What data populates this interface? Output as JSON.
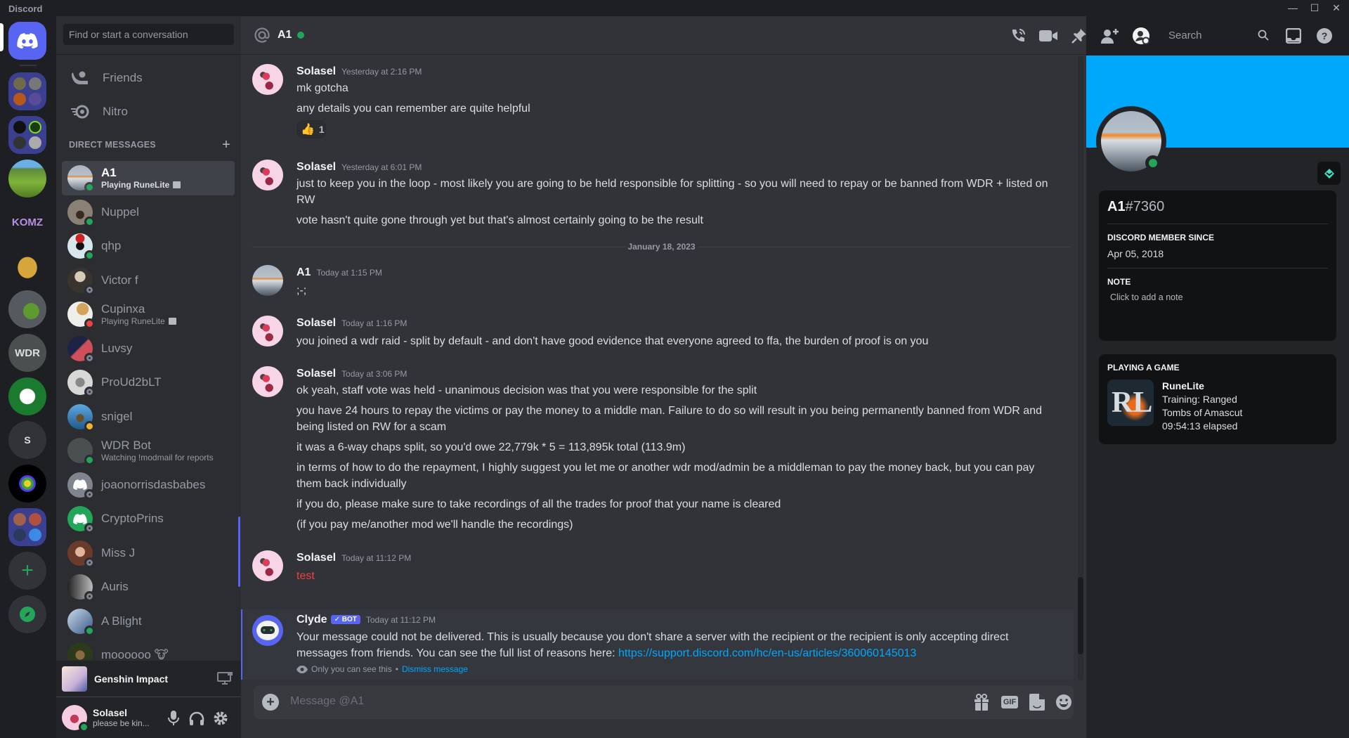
{
  "window": {
    "app_title": "Discord",
    "controls": {
      "minimize": "—",
      "maximize": "☐",
      "close": "✕"
    }
  },
  "server_rail": {
    "home_icon": "discord-logo-icon",
    "servers": [
      {
        "name": "folder-1",
        "kind": "folder"
      },
      {
        "name": "folder-2",
        "kind": "folder"
      },
      {
        "name": "corn-field-server",
        "kind": "image"
      },
      {
        "name": "komz-server",
        "kind": "image",
        "label": "KOMZ"
      },
      {
        "name": "spartan-helmet-server",
        "kind": "image"
      },
      {
        "name": "leaf-server",
        "kind": "image"
      },
      {
        "name": "wdr-server",
        "kind": "image",
        "label": "WDR"
      },
      {
        "name": "brain-server",
        "kind": "image"
      },
      {
        "name": "s-server",
        "kind": "text",
        "label": "S"
      },
      {
        "name": "rainbow-star-server",
        "kind": "image"
      },
      {
        "name": "folder-3",
        "kind": "folder"
      }
    ],
    "add_server_icon": "plus-icon",
    "explore_icon": "compass-icon"
  },
  "dm_sidebar": {
    "search_placeholder": "Find or start a conversation",
    "nav": [
      {
        "label": "Friends",
        "icon": "friends-icon"
      },
      {
        "label": "Nitro",
        "icon": "nitro-icon"
      }
    ],
    "section_title": "DIRECT MESSAGES",
    "add_dm_icon": "plus-icon",
    "dms": [
      {
        "name": "A1",
        "status": "online",
        "sub": "Playing RuneLite",
        "active": true
      },
      {
        "name": "Nuppel",
        "status": "online"
      },
      {
        "name": "qhp",
        "status": "online"
      },
      {
        "name": "Victor f",
        "status": "offline"
      },
      {
        "name": "Cupinxa",
        "status": "dnd",
        "sub": "Playing RuneLite"
      },
      {
        "name": "Luvsy",
        "status": "offline"
      },
      {
        "name": "ProUd2bLT",
        "status": "offline"
      },
      {
        "name": "snigel",
        "status": "idle"
      },
      {
        "name": "WDR Bot",
        "status": "online",
        "sub": "Watching !modmail for reports"
      },
      {
        "name": "joaonorrisdasbabes",
        "status": "offline"
      },
      {
        "name": "CryptoPrins",
        "status": "offline"
      },
      {
        "name": "Miss J",
        "status": "offline"
      },
      {
        "name": "Auris",
        "status": "offline"
      },
      {
        "name": "A Blight",
        "status": "online"
      },
      {
        "name": "moooooo 🐮",
        "status": "offline"
      }
    ],
    "activity": {
      "game": "Genshin Impact"
    },
    "user": {
      "name": "Solasel",
      "status_text": "please be kin...",
      "status": "online"
    }
  },
  "chat": {
    "header": {
      "title": "A1",
      "search_placeholder": "Search"
    },
    "header_icons": [
      "voice-call-icon",
      "video-call-icon",
      "pinned-messages-icon",
      "add-friends-to-dm-icon",
      "user-profile-icon",
      "inbox-icon",
      "help-icon"
    ],
    "messages": [
      {
        "author": "Solasel",
        "timestamp": "Yesterday at 2:16 PM",
        "lines": [
          "mk gotcha",
          "any details you can remember are quite helpful"
        ],
        "reaction": {
          "emoji": "👍",
          "count": "1"
        }
      },
      {
        "author": "Solasel",
        "timestamp": "Yesterday at 6:01 PM",
        "lines": [
          "just to keep you in the loop - most likely you are going to be held responsible for splitting - so you will need to repay or be banned from WDR + listed on RW",
          "vote hasn't quite gone through yet but that's almost certainly going to be the result"
        ]
      },
      {
        "author": "A1",
        "timestamp": "Today at 1:15 PM",
        "lines": [
          ";-;"
        ]
      },
      {
        "author": "Solasel",
        "timestamp": "Today at 1:16 PM",
        "lines": [
          "you joined a wdr raid - split by default - and don't have good evidence that everyone agreed to ffa, the burden of proof is on you"
        ]
      },
      {
        "author": "Solasel",
        "timestamp": "Today at 3:06 PM",
        "lines": [
          "ok yeah, staff vote was held - unanimous decision was that you were responsible for the split",
          "you have 24 hours to repay the victims or pay the money to a middle man. Failure to do so will result in you being permanently banned from WDR and being listed on RW for a scam",
          "it was a 6-way chaps split, so you'd owe 22,779k * 5  = 113,895k total (113.9m)",
          "in terms of how to do the repayment, I highly suggest you let me or another wdr mod/admin be a middleman to pay the money back, but you can pay them back individually",
          "if you do, please make sure to take recordings of all the trades for proof that your name is cleared",
          "(if you pay me/another mod we'll handle the recordings)"
        ]
      },
      {
        "author": "Solasel",
        "timestamp": "Today at 11:12 PM",
        "lines": [
          "test"
        ],
        "failed": true
      },
      {
        "author": "Clyde",
        "badge": "✓ BOT",
        "timestamp": "Today at 11:12 PM",
        "text": "Your message could not be delivered. This is usually because you don't share a server with the recipient or the recipient is only accepting direct messages from friends. You can see the full list of reasons here: ",
        "link": "https://support.discord.com/hc/en-us/articles/360060145013",
        "ephemeral_note": "Only you can see this",
        "dismiss": "Dismiss message"
      }
    ],
    "date_divider": "January 18, 2023",
    "composer": {
      "placeholder": "Message @A1",
      "gif_label": "GIF"
    }
  },
  "profile": {
    "username": "A1",
    "discriminator": "#7360",
    "banner_color": "#00a8fc",
    "member_since_label": "DISCORD MEMBER SINCE",
    "member_since": "Apr 05, 2018",
    "note_label": "NOTE",
    "note_placeholder": "Click to add a note",
    "activity_label": "PLAYING A GAME",
    "activity": {
      "name": "RuneLite",
      "details": "Training: Ranged",
      "state": "Tombs of Amascut",
      "elapsed": "09:54:13 elapsed",
      "logo": "RL"
    }
  }
}
